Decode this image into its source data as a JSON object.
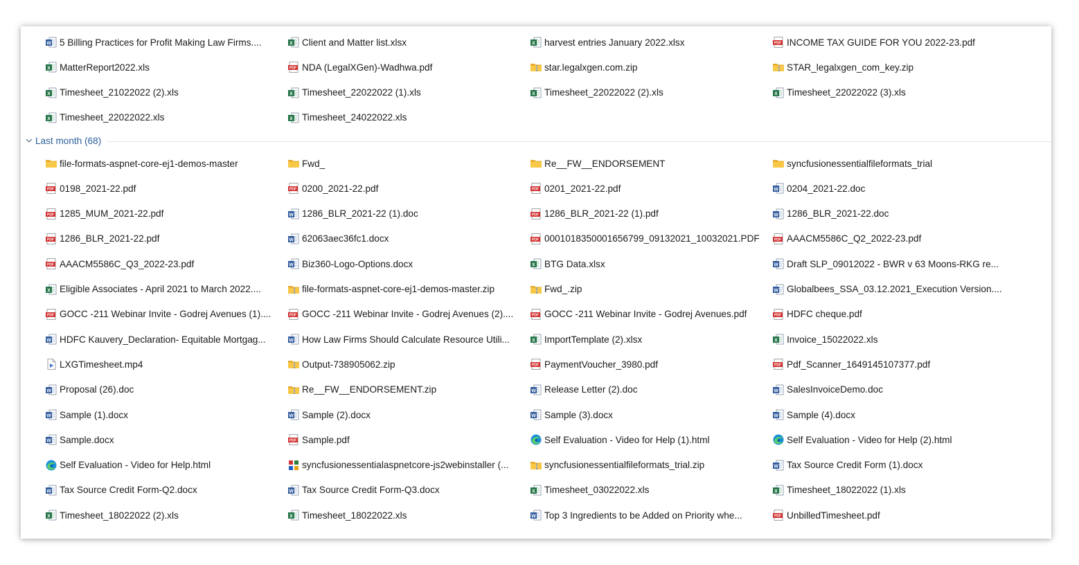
{
  "colors": {
    "group_header": "#2b5e9a",
    "word": "#2b579a",
    "excel": "#217346",
    "pdf": "#d22c2c",
    "folder": "#f4c542"
  },
  "earlier_group": {
    "items": [
      {
        "name": "5 Billing Practices for Profit Making Law Firms....",
        "icon": "word-doc-icon"
      },
      {
        "name": "Client and Matter list.xlsx",
        "icon": "excel-xlsx-icon"
      },
      {
        "name": "harvest entries January 2022.xlsx",
        "icon": "excel-xlsx-icon"
      },
      {
        "name": "INCOME TAX GUIDE FOR YOU  2022-23.pdf",
        "icon": "pdf-icon"
      },
      {
        "name": "MatterReport2022.xls",
        "icon": "excel-xls-icon"
      },
      {
        "name": "NDA (LegalXGen)-Wadhwa.pdf",
        "icon": "pdf-icon"
      },
      {
        "name": "star.legalxgen.com.zip",
        "icon": "zip-folder-icon"
      },
      {
        "name": "STAR_legalxgen_com_key.zip",
        "icon": "zip-folder-icon"
      },
      {
        "name": "Timesheet_21022022 (2).xls",
        "icon": "excel-xls-icon"
      },
      {
        "name": "Timesheet_22022022 (1).xls",
        "icon": "excel-xls-icon"
      },
      {
        "name": "Timesheet_22022022 (2).xls",
        "icon": "excel-xls-icon"
      },
      {
        "name": "Timesheet_22022022 (3).xls",
        "icon": "excel-xls-icon"
      },
      {
        "name": "Timesheet_22022022.xls",
        "icon": "excel-xls-icon"
      },
      {
        "name": "Timesheet_24022022.xls",
        "icon": "excel-xls-icon"
      }
    ]
  },
  "last_month_group": {
    "label": "Last month (68)",
    "items": [
      {
        "name": "file-formats-aspnet-core-ej1-demos-master",
        "icon": "folder-icon"
      },
      {
        "name": "Fwd_",
        "icon": "folder-icon"
      },
      {
        "name": "Re__FW__ENDORSEMENT",
        "icon": "folder-icon"
      },
      {
        "name": "syncfusionessentialfileformats_trial",
        "icon": "folder-icon"
      },
      {
        "name": "0198_2021-22.pdf",
        "icon": "pdf-icon"
      },
      {
        "name": "0200_2021-22.pdf",
        "icon": "pdf-icon"
      },
      {
        "name": "0201_2021-22.pdf",
        "icon": "pdf-icon"
      },
      {
        "name": "0204_2021-22.doc",
        "icon": "word-doc-icon"
      },
      {
        "name": "1285_MUM_2021-22.pdf",
        "icon": "pdf-icon"
      },
      {
        "name": "1286_BLR_2021-22 (1).doc",
        "icon": "word-doc-icon"
      },
      {
        "name": "1286_BLR_2021-22 (1).pdf",
        "icon": "pdf-icon"
      },
      {
        "name": "1286_BLR_2021-22.doc",
        "icon": "word-doc-icon"
      },
      {
        "name": "1286_BLR_2021-22.pdf",
        "icon": "pdf-icon"
      },
      {
        "name": "62063aec36fc1.docx",
        "icon": "word-docx-icon"
      },
      {
        "name": "0001018350001656799_09132021_10032021.PDF",
        "icon": "pdf-icon"
      },
      {
        "name": "AAACM5586C_Q2_2022-23.pdf",
        "icon": "pdf-icon"
      },
      {
        "name": "AAACM5586C_Q3_2022-23.pdf",
        "icon": "pdf-icon"
      },
      {
        "name": "Biz360-Logo-Options.docx",
        "icon": "word-docx-icon"
      },
      {
        "name": "BTG Data.xlsx",
        "icon": "excel-xlsx-icon"
      },
      {
        "name": "Draft SLP_09012022 - BWR v 63 Moons-RKG re...",
        "icon": "word-docx-icon"
      },
      {
        "name": "Eligible Associates - April 2021 to March 2022....",
        "icon": "excel-xlsx-icon"
      },
      {
        "name": "file-formats-aspnet-core-ej1-demos-master.zip",
        "icon": "zip-folder-icon"
      },
      {
        "name": "Fwd_.zip",
        "icon": "zip-folder-icon"
      },
      {
        "name": "Globalbees_SSA_03.12.2021_Execution Version....",
        "icon": "word-docx-icon"
      },
      {
        "name": "GOCC -211 Webinar Invite - Godrej Avenues (1)....",
        "icon": "pdf-icon"
      },
      {
        "name": "GOCC -211 Webinar Invite - Godrej Avenues (2)....",
        "icon": "pdf-icon"
      },
      {
        "name": "GOCC -211 Webinar Invite - Godrej Avenues.pdf",
        "icon": "pdf-icon"
      },
      {
        "name": "HDFC cheque.pdf",
        "icon": "pdf-icon"
      },
      {
        "name": "HDFC Kauvery_Declaration- Equitable Mortgag...",
        "icon": "word-docx-icon"
      },
      {
        "name": "How Law Firms Should Calculate Resource Utili...",
        "icon": "word-docx-icon"
      },
      {
        "name": "ImportTemplate (2).xlsx",
        "icon": "excel-xlsx-icon"
      },
      {
        "name": "Invoice_15022022.xls",
        "icon": "excel-xls-icon"
      },
      {
        "name": "LXGTimesheet.mp4",
        "icon": "video-file-icon"
      },
      {
        "name": "Output-738905062.zip",
        "icon": "zip-folder-icon"
      },
      {
        "name": "PaymentVoucher_3980.pdf",
        "icon": "pdf-icon"
      },
      {
        "name": "Pdf_Scanner_1649145107377.pdf",
        "icon": "pdf-icon"
      },
      {
        "name": "Proposal (26).doc",
        "icon": "word-doc-icon"
      },
      {
        "name": "Re__FW__ENDORSEMENT.zip",
        "icon": "zip-folder-icon"
      },
      {
        "name": "Release Letter (2).doc",
        "icon": "word-doc-icon"
      },
      {
        "name": "SalesInvoiceDemo.doc",
        "icon": "word-doc-icon"
      },
      {
        "name": "Sample (1).docx",
        "icon": "word-docx-icon"
      },
      {
        "name": "Sample (2).docx",
        "icon": "word-docx-icon"
      },
      {
        "name": "Sample (3).docx",
        "icon": "word-docx-icon"
      },
      {
        "name": "Sample (4).docx",
        "icon": "word-docx-icon"
      },
      {
        "name": "Sample.docx",
        "icon": "word-docx-icon"
      },
      {
        "name": "Sample.pdf",
        "icon": "pdf-icon"
      },
      {
        "name": "Self Evaluation - Video for Help (1).html",
        "icon": "edge-browser-icon"
      },
      {
        "name": "Self Evaluation - Video for Help (2).html",
        "icon": "edge-browser-icon"
      },
      {
        "name": "Self Evaluation - Video for Help.html",
        "icon": "edge-browser-icon"
      },
      {
        "name": "syncfusionessentialaspnetcore-js2webinstaller (...",
        "icon": "installer-icon"
      },
      {
        "name": "syncfusionessentialfileformats_trial.zip",
        "icon": "zip-folder-icon"
      },
      {
        "name": "Tax Source Credit Form (1).docx",
        "icon": "word-docx-icon"
      },
      {
        "name": "Tax Source Credit Form-Q2.docx",
        "icon": "word-docx-icon"
      },
      {
        "name": "Tax Source Credit Form-Q3.docx",
        "icon": "word-docx-icon"
      },
      {
        "name": "Timesheet_03022022.xls",
        "icon": "excel-xls-icon"
      },
      {
        "name": "Timesheet_18022022 (1).xls",
        "icon": "excel-xls-icon"
      },
      {
        "name": "Timesheet_18022022 (2).xls",
        "icon": "excel-xls-icon"
      },
      {
        "name": "Timesheet_18022022.xls",
        "icon": "excel-xls-icon"
      },
      {
        "name": "Top 3 Ingredients to be Added on Priority whe...",
        "icon": "word-docx-icon"
      },
      {
        "name": "UnbilledTimesheet.pdf",
        "icon": "pdf-icon"
      }
    ]
  }
}
